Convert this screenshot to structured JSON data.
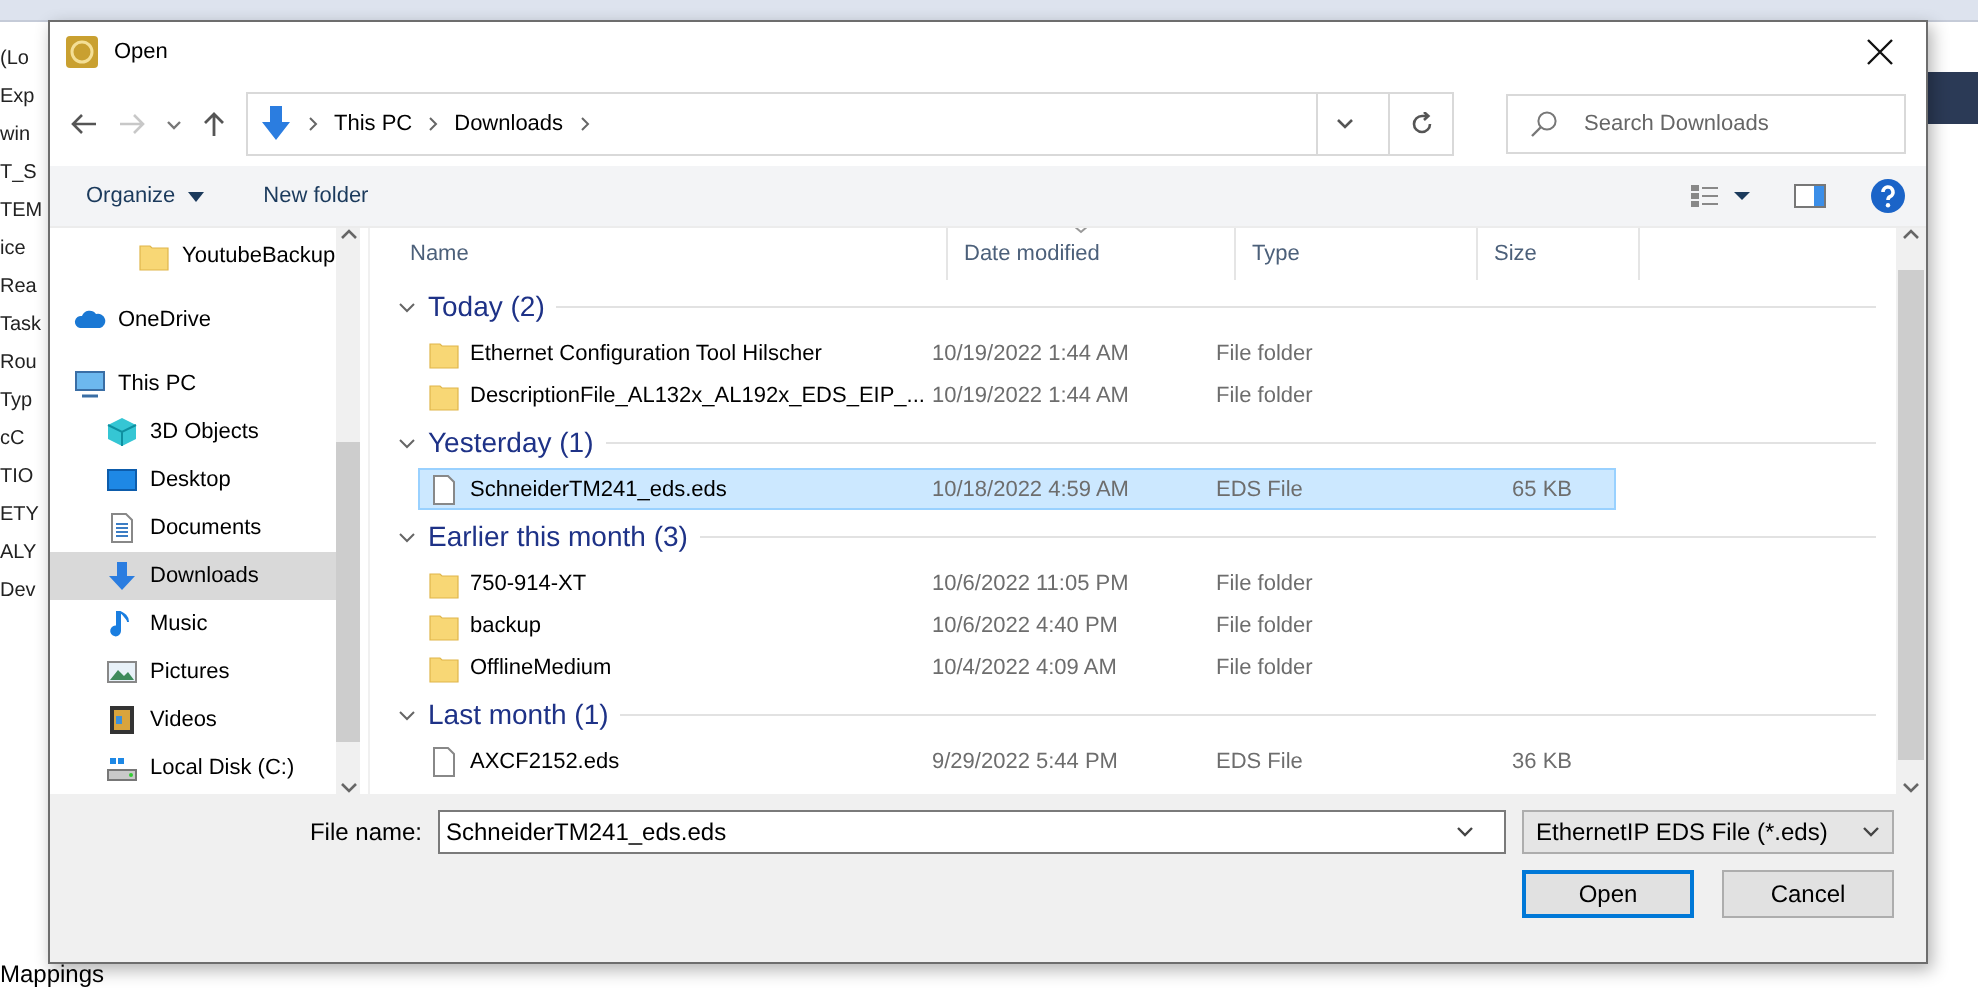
{
  "background_app": {
    "left_labels": [
      "(Lo",
      "Exp",
      "win",
      "T_S",
      "TEM",
      "ice",
      "Rea",
      "Task",
      "Rou",
      "Typ",
      "cC",
      "TIO",
      "ETY",
      "ALY",
      "Dev"
    ],
    "bottom_label": "Mappings"
  },
  "window": {
    "title": "Open"
  },
  "address_bar": {
    "path": [
      "This PC",
      "Downloads"
    ]
  },
  "search": {
    "placeholder": "Search Downloads"
  },
  "toolbar": {
    "organize": "Organize",
    "new_folder": "New folder"
  },
  "sidebar": {
    "items": [
      {
        "children": [
          {
            "label": "YoutubeBackup",
            "kind": "folder",
            "selected": false
          }
        ]
      },
      {
        "label": "OneDrive",
        "kind": "cloud",
        "selected": false
      },
      {
        "label": "This PC",
        "kind": "pc",
        "selected": false,
        "children": [
          {
            "label": "3D Objects",
            "kind": "cube",
            "selected": false
          },
          {
            "label": "Desktop",
            "kind": "desktop",
            "selected": false
          },
          {
            "label": "Documents",
            "kind": "document",
            "selected": false
          },
          {
            "label": "Downloads",
            "kind": "download",
            "selected": true
          },
          {
            "label": "Music",
            "kind": "music",
            "selected": false
          },
          {
            "label": "Pictures",
            "kind": "pictures",
            "selected": false
          },
          {
            "label": "Videos",
            "kind": "videos",
            "selected": false
          },
          {
            "label": "Local Disk (C:)",
            "kind": "disk",
            "selected": false
          }
        ]
      }
    ]
  },
  "file_list": {
    "columns": [
      "Name",
      "Date modified",
      "Type",
      "Size"
    ],
    "groups": [
      {
        "label": "Today (2)",
        "expanded": true,
        "rows": [
          {
            "kind": "folder",
            "name": "Ethernet Configuration Tool Hilscher",
            "date": "10/19/2022 1:44 AM",
            "type": "File folder",
            "selected": false
          },
          {
            "kind": "folder",
            "name": "DescriptionFile_AL132x_AL192x_EDS_EIP_...",
            "date": "10/19/2022 1:44 AM",
            "type": "File folder",
            "selected": false
          }
        ]
      },
      {
        "label": "Yesterday (1)",
        "expanded": true,
        "rows": [
          {
            "kind": "file",
            "name": "SchneiderTM241_eds.eds",
            "date": "10/18/2022 4:59 AM",
            "type": "EDS File",
            "size": "65 KB",
            "selected": true
          }
        ]
      },
      {
        "label": "Earlier this month (3)",
        "expanded": true,
        "rows": [
          {
            "kind": "folder",
            "name": "750-914-XT",
            "date": "10/6/2022 11:05 PM",
            "type": "File folder",
            "selected": false
          },
          {
            "kind": "folder",
            "name": "backup",
            "date": "10/6/2022 4:40 PM",
            "type": "File folder",
            "selected": false
          },
          {
            "kind": "folder",
            "name": "OfflineMedium",
            "date": "10/4/2022 4:09 AM",
            "type": "File folder",
            "selected": false
          }
        ]
      },
      {
        "label": "Last month (1)",
        "expanded": true,
        "rows": [
          {
            "kind": "file",
            "name": "AXCF2152.eds",
            "date": "9/29/2022 5:44 PM",
            "type": "EDS File",
            "size": "36 KB",
            "selected": false
          }
        ]
      }
    ]
  },
  "file_name": {
    "label": "File name:",
    "value": "SchneiderTM241_eds.eds"
  },
  "file_type": {
    "value": "EthernetIP EDS File (*.eds)"
  },
  "buttons": [
    {
      "label": "Open",
      "default": true
    },
    {
      "label": "Cancel",
      "default": false
    }
  ]
}
